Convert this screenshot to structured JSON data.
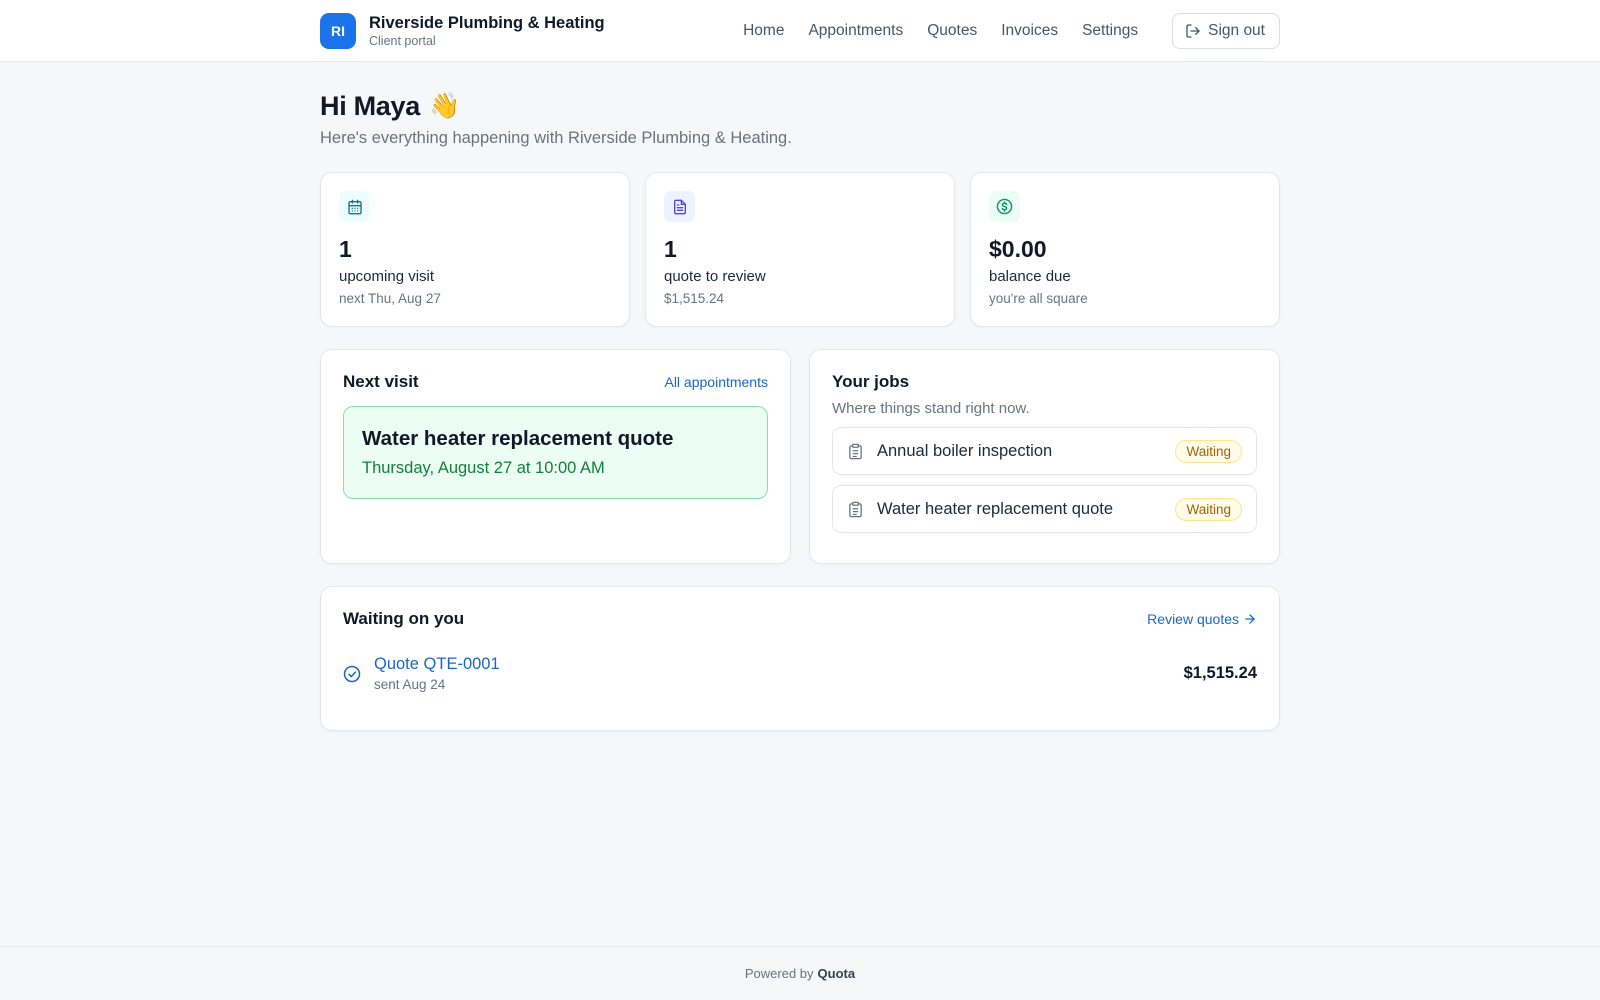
{
  "header": {
    "logo_initials": "RI",
    "company_name": "Riverside Plumbing & Heating",
    "portal_label": "Client portal",
    "nav": [
      {
        "label": "Home"
      },
      {
        "label": "Appointments"
      },
      {
        "label": "Quotes"
      },
      {
        "label": "Invoices"
      },
      {
        "label": "Settings"
      }
    ],
    "sign_out_label": "Sign out",
    "sign_out_icon": "sign-out-icon",
    "brand_color": "#1a73e8"
  },
  "greeting": {
    "title": "Hi Maya",
    "emoji": "👋",
    "subtitle": "Here's everything happening with Riverside Plumbing & Heating."
  },
  "stats": [
    {
      "icon": "calendar-icon",
      "value": "1",
      "label": "upcoming visit",
      "hint": "next Thu, Aug 27",
      "icon_color": "#0e7490",
      "icon_bg": "#ecfeff"
    },
    {
      "icon": "document-icon",
      "value": "1",
      "label": "quote to review",
      "hint": "$1,515.24",
      "icon_color": "#4f46e5",
      "icon_bg": "#eef2ff"
    },
    {
      "icon": "dollar-icon",
      "value": "$0.00",
      "label": "balance due",
      "hint": "you're all square",
      "icon_color": "#059669",
      "icon_bg": "#ecfdf5"
    }
  ],
  "next_visit": {
    "title": "Next visit",
    "link_label": "All appointments",
    "visit_title": "Water heater replacement quote",
    "visit_time": "Thursday, August 27 at 10:00 AM"
  },
  "jobs": {
    "title": "Your jobs",
    "subtitle": "Where things stand right now.",
    "items": [
      {
        "name": "Annual boiler inspection",
        "status": "Waiting",
        "icon": "clipboard-icon"
      },
      {
        "name": "Water heater replacement quote",
        "status": "Waiting",
        "icon": "clipboard-icon"
      }
    ]
  },
  "waiting": {
    "title": "Waiting on you",
    "link_label": "Review quotes",
    "items": [
      {
        "name": "Quote QTE-0001",
        "date": "sent Aug 24",
        "amount": "$1,515.24",
        "icon": "check-circle-icon"
      }
    ]
  },
  "footer": {
    "powered_by": "Powered by",
    "vendor": "Quota"
  }
}
